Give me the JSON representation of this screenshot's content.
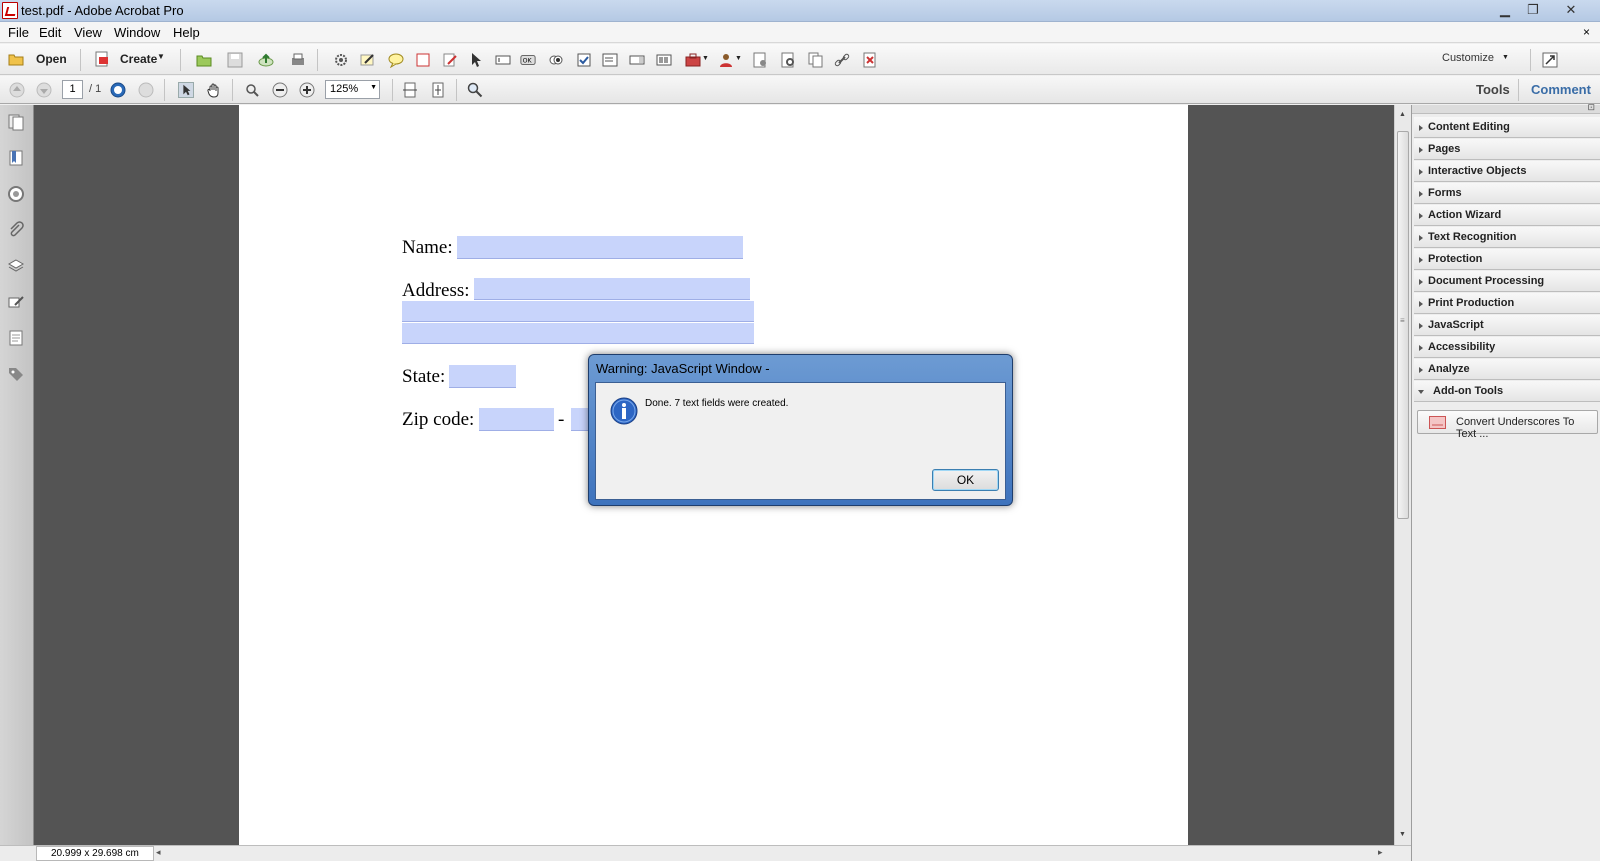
{
  "window": {
    "title": "test.pdf - Adobe Acrobat Pro",
    "min": "▁",
    "max": "❐",
    "close": "✕"
  },
  "menubar": {
    "items": [
      "File",
      "Edit",
      "View",
      "Window",
      "Help"
    ],
    "close_doc": "×"
  },
  "toolbar1": {
    "open_label": "Open",
    "create_label": "Create",
    "customize_label": "Customize"
  },
  "toolbar2": {
    "page_current": "1",
    "page_total": "/ 1",
    "zoom": "125%",
    "tools_tab": "Tools",
    "comment_tab": "Comment"
  },
  "form": {
    "name_label": "Name:",
    "address_label": "Address:",
    "state_label": "State:",
    "zip_label": "Zip code:",
    "zip_dash": "-"
  },
  "status": {
    "page_size": "20.999 x 29.698 cm"
  },
  "panel": {
    "sections": [
      "Content Editing",
      "Pages",
      "Interactive Objects",
      "Forms",
      "Action Wizard",
      "Text Recognition",
      "Protection",
      "Document Processing",
      "Print Production",
      "JavaScript",
      "Accessibility",
      "Analyze",
      "Add-on Tools"
    ],
    "addon_item": "Convert Underscores To Text ..."
  },
  "dialog": {
    "title": "Warning: JavaScript Window -",
    "message": "Done. 7 text fields were created.",
    "ok_label": "OK"
  },
  "colors": {
    "form_field": "#c8d4fb",
    "doc_background": "#545454",
    "dialog_frame": "#3e73bd"
  }
}
